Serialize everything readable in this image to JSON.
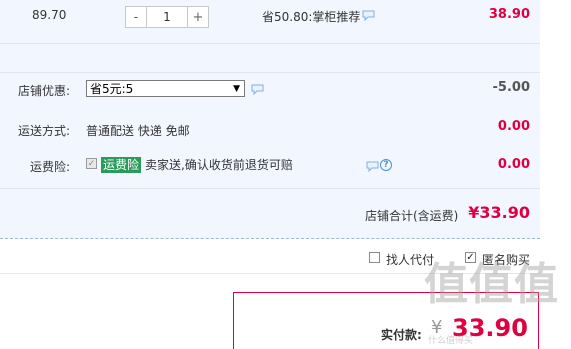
{
  "item": {
    "unit_price": "89.70",
    "quantity": "1",
    "minus_label": "-",
    "plus_label": "+",
    "promo_text": "省50.80:掌柜推荐",
    "total": "38.90"
  },
  "store_discount": {
    "label": "店铺优惠:",
    "selected": "省5元:5",
    "amount": "-5.00"
  },
  "shipping": {
    "label": "运送方式:",
    "method": "普通配送 快递 免邮",
    "fee": "0.00"
  },
  "shipping_insurance": {
    "label": "运费险:",
    "tag": "运费险",
    "text": "卖家送,确认收货前退货可赔",
    "help_icon_text": "?",
    "fee": "0.00"
  },
  "subtotal": {
    "label": "店铺合计(含运费)",
    "value": "¥33.90"
  },
  "options": {
    "proxy_pay_label": "找人代付",
    "proxy_pay_checked": false,
    "anonymous_label": "匿名购买",
    "anonymous_checked": true
  },
  "payment": {
    "label": "实付款:",
    "currency": "¥",
    "amount": "33.90"
  },
  "watermark": {
    "main": "值值值",
    "sub": "什么值得买"
  },
  "colors": {
    "price_red": "#e0003f",
    "panel_bg": "#f2f7ff",
    "tag_green": "#2b9b5b"
  }
}
